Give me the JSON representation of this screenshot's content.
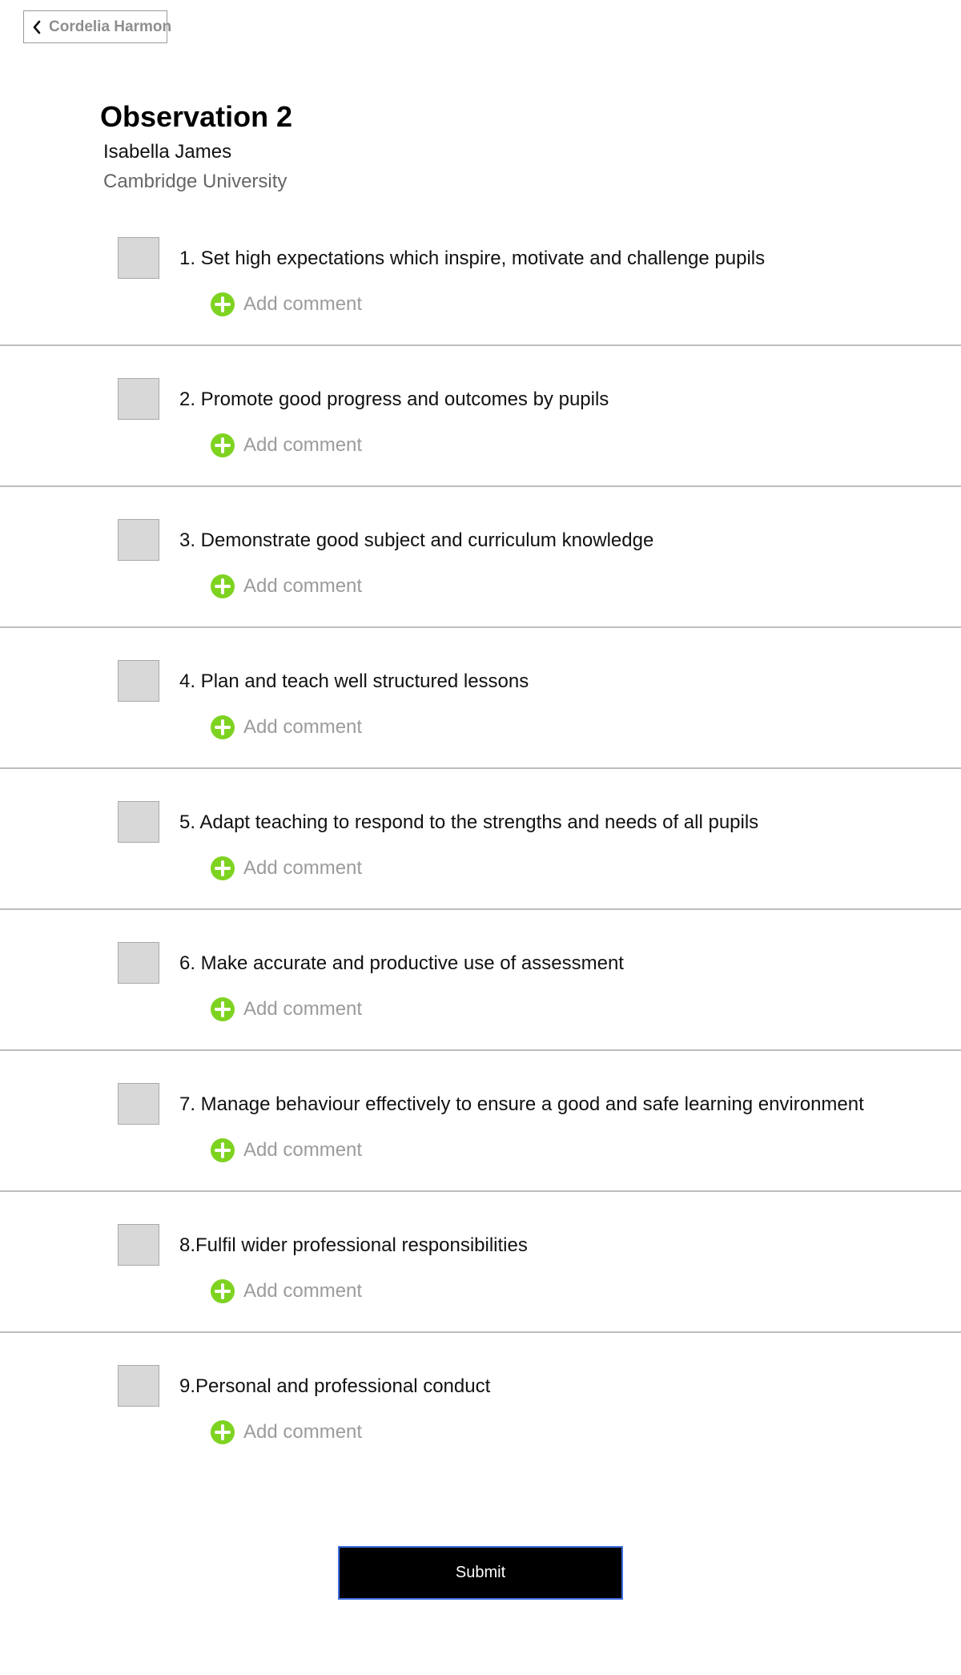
{
  "nav": {
    "back_label": "Cordelia Harmon",
    "back_icon": "chevron-left-icon"
  },
  "header": {
    "title": "Observation 2",
    "student": "Isabella James",
    "institution": "Cambridge University"
  },
  "criteria": [
    {
      "label": "1. Set high expectations which inspire, motivate and challenge pupils",
      "checked": false,
      "comment_label": "Add comment"
    },
    {
      "label": "2. Promote good progress and outcomes by pupils",
      "checked": false,
      "comment_label": "Add comment"
    },
    {
      "label": "3. Demonstrate good subject and curriculum knowledge",
      "checked": false,
      "comment_label": "Add comment"
    },
    {
      "label": "4. Plan and teach well structured lessons",
      "checked": false,
      "comment_label": "Add comment"
    },
    {
      "label": "5. Adapt teaching to respond to the strengths and needs of all pupils",
      "checked": false,
      "comment_label": "Add comment"
    },
    {
      "label": "6. Make accurate and productive use of assessment",
      "checked": false,
      "comment_label": "Add comment"
    },
    {
      "label": "7. Manage behaviour effectively to ensure a good and safe learning environment",
      "checked": false,
      "comment_label": "Add comment"
    },
    {
      "label": "8.Fulfil wider professional responsibilities",
      "checked": false,
      "comment_label": "Add comment"
    },
    {
      "label": "9.Personal and professional conduct",
      "checked": false,
      "comment_label": "Add comment"
    }
  ],
  "add_comment_icon": "plus-circle-icon",
  "colors": {
    "accent_green": "#7ed321",
    "submit_background": "#000000",
    "submit_border": "#3f6fe0"
  },
  "submit": {
    "label": "Submit"
  }
}
